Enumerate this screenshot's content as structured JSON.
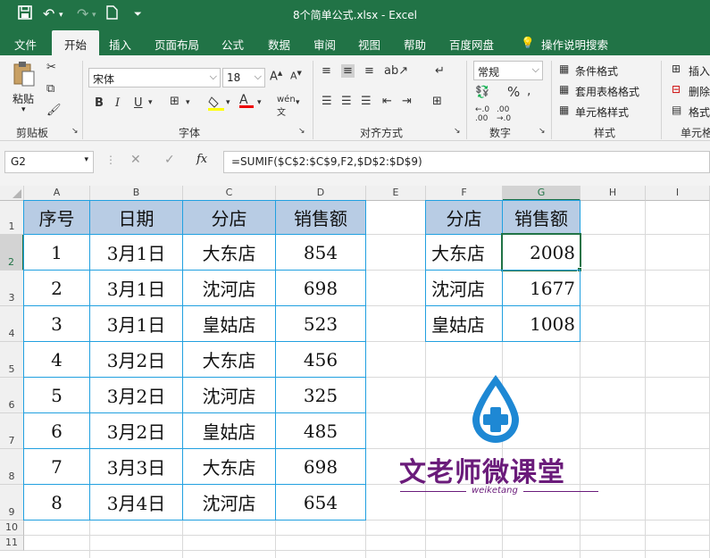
{
  "titlebar": {
    "title": "8个简单公式.xlsx  -  Excel"
  },
  "tabs": [
    "文件",
    "开始",
    "插入",
    "页面布局",
    "公式",
    "数据",
    "审阅",
    "视图",
    "帮助",
    "百度网盘"
  ],
  "tell_me": "操作说明搜索",
  "ribbon": {
    "clipboard": {
      "paste": "粘贴",
      "label": "剪贴板"
    },
    "font": {
      "name": "宋体",
      "size": "18",
      "bold": "B",
      "italic": "I",
      "underline": "U",
      "label": "字体"
    },
    "alignment": {
      "label": "对齐方式"
    },
    "number": {
      "format": "常规",
      "label": "数字",
      "percent": "%"
    },
    "styles": {
      "cond": "条件格式",
      "table": "套用表格格式",
      "cell": "单元格样式",
      "label": "样式"
    },
    "cells": {
      "insert": "插入",
      "delete": "删除",
      "format": "格式",
      "label": "单元格"
    }
  },
  "formula_bar": {
    "name_box": "G2",
    "formula": "=SUMIF($C$2:$C$9,F2,$D$2:$D$9)",
    "fx": "fx"
  },
  "columns": [
    "A",
    "B",
    "C",
    "D",
    "E",
    "F",
    "G",
    "H",
    "I"
  ],
  "rows": [
    "1",
    "2",
    "3",
    "4",
    "5",
    "6",
    "7",
    "8",
    "9",
    "10",
    "11"
  ],
  "table1": {
    "headers": [
      "序号",
      "日期",
      "分店",
      "销售额"
    ],
    "rows": [
      [
        "1",
        "3月1日",
        "大东店",
        "854"
      ],
      [
        "2",
        "3月1日",
        "沈河店",
        "698"
      ],
      [
        "3",
        "3月1日",
        "皇姑店",
        "523"
      ],
      [
        "4",
        "3月2日",
        "大东店",
        "456"
      ],
      [
        "5",
        "3月2日",
        "沈河店",
        "325"
      ],
      [
        "6",
        "3月2日",
        "皇姑店",
        "485"
      ],
      [
        "7",
        "3月3日",
        "大东店",
        "698"
      ],
      [
        "8",
        "3月4日",
        "沈河店",
        "654"
      ]
    ]
  },
  "table2": {
    "headers": [
      "分店",
      "销售额"
    ],
    "rows": [
      [
        "大东店",
        "2008"
      ],
      [
        "沈河店",
        "1677"
      ],
      [
        "皇姑店",
        "1008"
      ]
    ]
  },
  "watermark": {
    "main": "文老师微课堂",
    "sub": "weiketang",
    "color": "#6a1b7a",
    "drop_color": "#1e88d4"
  }
}
